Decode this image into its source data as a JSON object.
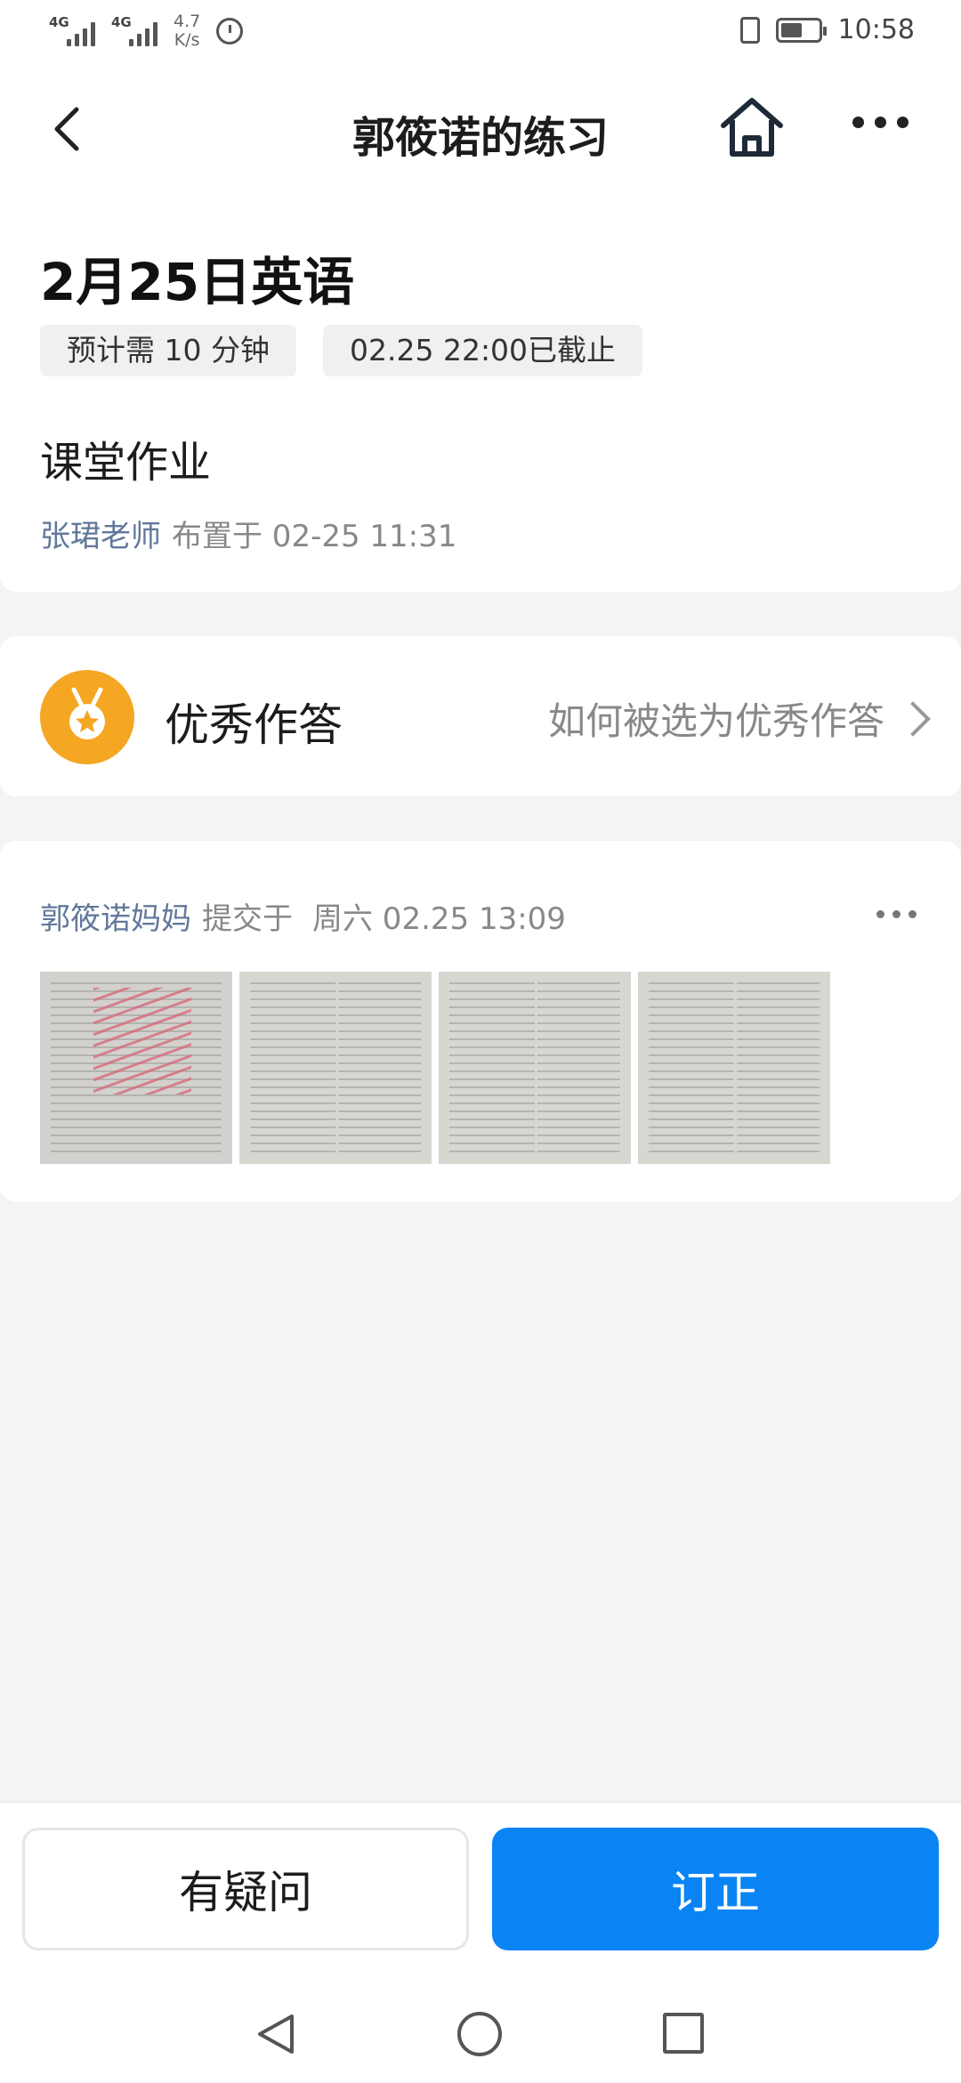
{
  "status_bar": {
    "signal1": "4G",
    "signal2": "4G",
    "net_speed_value": "4.7",
    "net_speed_unit": "K/s",
    "time": "10:58",
    "battery_level": 0.5
  },
  "navbar": {
    "title": "郭筱诺的练习"
  },
  "assignment": {
    "title": "2月25日英语",
    "chips": [
      "预计需 10 分钟",
      "02.25 22:00已截止"
    ],
    "subtitle": "课堂作业",
    "teacher": "张珺老师",
    "assigned_text": "布置于 02-25 11:31"
  },
  "excellent": {
    "label": "优秀作答",
    "link": "如何被选为优秀作答"
  },
  "submission": {
    "submitter": "郭筱诺妈妈",
    "action": "提交于",
    "time": "周六 02.25 13:09"
  },
  "buttons": {
    "question": "有疑问",
    "correct": "订正"
  },
  "colors": {
    "accent": "#0a84f4",
    "link_name": "#62789a",
    "medal": "#f5a623"
  }
}
